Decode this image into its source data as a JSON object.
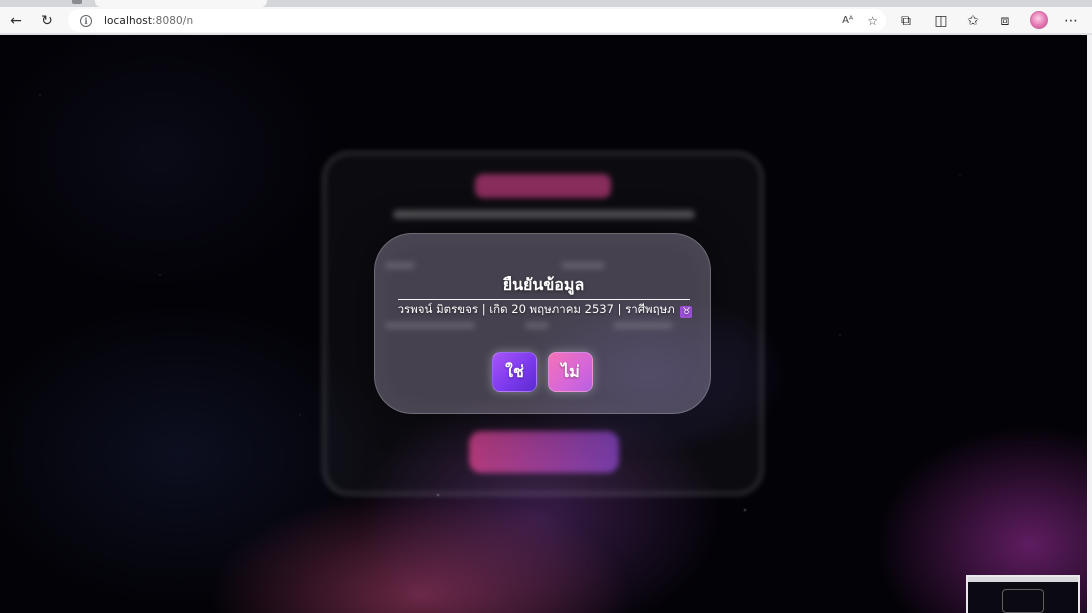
{
  "browser": {
    "url_host": "localhost",
    "url_rest": ":8080/n",
    "icons": [
      "back-icon",
      "reload-icon",
      "info-icon",
      "read-aloud-icon",
      "favorite-star-icon",
      "extensions-icon",
      "split-screen-icon",
      "favorites-icon",
      "collections-icon",
      "profile-avatar",
      "more-menu-icon"
    ],
    "glyphs": {
      "back": "←",
      "reload": "↻",
      "info": "i",
      "read_aloud": "Aᴬ",
      "star": "☆",
      "extensions": "⧉",
      "split": "◫",
      "favorites": "✩",
      "collections": "⧈",
      "more": "⋯"
    }
  },
  "modal": {
    "title": "ยืนยันข้อมูล",
    "info_text": "วรพจน์ มิตรขจร | เกิด 20 พฤษภาคม 2537 | ราศีพฤษภ",
    "zodiac_symbol": "♉",
    "yes_label": "ใช่",
    "no_label": "ไม่"
  },
  "colors": {
    "yes_button": "#7c3aed",
    "no_button": "#f472b6",
    "background": "#030207",
    "bg_card_title": "#ec4899"
  }
}
